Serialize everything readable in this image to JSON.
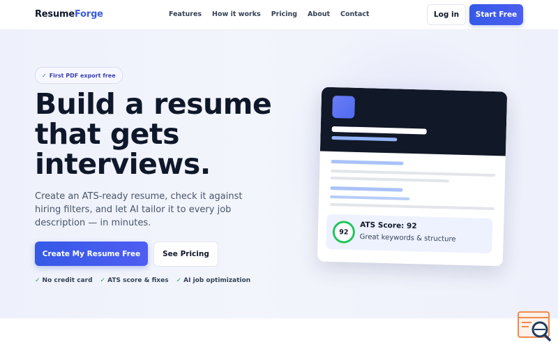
{
  "brand": {
    "part1": "Resume",
    "part2": "Forge"
  },
  "nav": {
    "items": [
      "Features",
      "How it works",
      "Pricing",
      "About",
      "Contact"
    ]
  },
  "header": {
    "login_label": "Log in",
    "start_label": "Start Free"
  },
  "hero": {
    "badge": "First PDF export free",
    "headline": "Build a resume that gets interviews.",
    "subtitle": "Create an ATS-ready resume, check it against hiring filters, and let AI tailor it to every job description — in minutes.",
    "primary_cta": "Create My Resume Free",
    "secondary_cta": "See Pricing",
    "perks": [
      "No credit card",
      "ATS score & fixes",
      "AI job optimization"
    ]
  },
  "preview": {
    "score_value": "92",
    "score_title": "ATS Score: 92",
    "score_desc": "Great keywords & structure"
  },
  "icons": {
    "check": "check-icon",
    "support": "support-search-icon"
  },
  "colors": {
    "accent": "#3b5bdb",
    "dark": "#111827",
    "success": "#22c55e"
  }
}
